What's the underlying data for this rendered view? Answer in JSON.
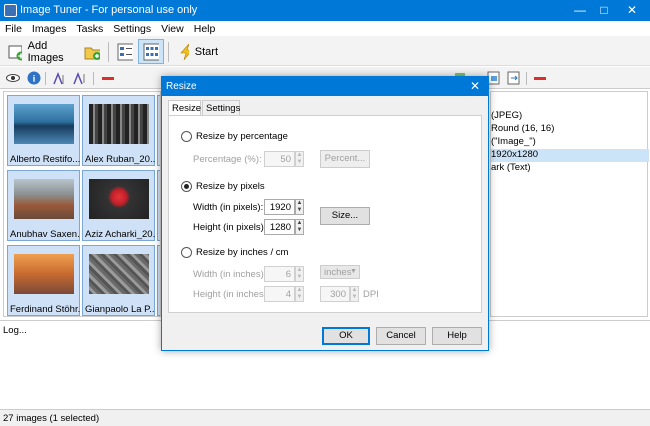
{
  "window": {
    "title": "Image Tuner - For personal use only"
  },
  "menu": [
    "File",
    "Images",
    "Tasks",
    "Settings",
    "View",
    "Help"
  ],
  "toolbar": {
    "add_images": "Add Images",
    "start": "Start"
  },
  "thumbnails": [
    "Alberto Restifo...",
    "Alex Ruban_20...",
    "Anubhav Saxen...",
    "Aziz Acharki_20...",
    "Ferdinand Stöhr...",
    "Gianpaolo La P..."
  ],
  "right_panel": [
    "(JPEG)",
    "Round (16, 16)",
    "(\"Image_\")",
    "1920x1280",
    "ark (Text)"
  ],
  "log": {
    "label": "Log..."
  },
  "status": {
    "text": "27 images (1 selected)"
  },
  "dialog": {
    "title": "Resize",
    "tabs": [
      "Resize",
      "Settings"
    ],
    "percentage": {
      "radio_label": "Resize by percentage",
      "field_label": "Percentage (%):",
      "value": "50",
      "button": "Percent..."
    },
    "pixels": {
      "radio_label": "Resize by pixels",
      "width_label": "Width (in pixels):",
      "width_value": "1920",
      "height_label": "Height (in pixels):",
      "height_value": "1280",
      "button": "Size..."
    },
    "inches": {
      "radio_label": "Resize by inches / cm",
      "width_label": "Width (in inches):",
      "width_value": "6",
      "height_label": "Height (in inches):",
      "height_value": "4",
      "unit_selected": "inches",
      "dpi_value": "300",
      "dpi_label": "DPI"
    },
    "buttons": {
      "ok": "OK",
      "cancel": "Cancel",
      "help": "Help"
    }
  }
}
